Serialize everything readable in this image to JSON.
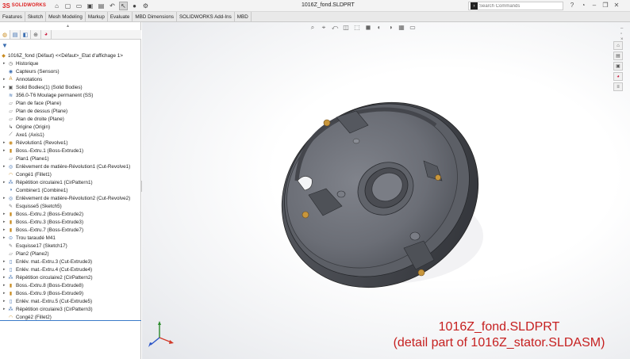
{
  "app": {
    "logo_ds": "3S",
    "logo_text": "SOLIDWORKS"
  },
  "window": {
    "title": "1016Z_fond.SLDPRT"
  },
  "search": {
    "placeholder": "Search Commands"
  },
  "title_icons": [
    "help-icon",
    "user-icon",
    "minimize-icon",
    "restore-icon",
    "close-icon"
  ],
  "quick_access": [
    "home-icon",
    "new-icon",
    "open-icon",
    "save-icon",
    "print-icon",
    "undo-icon",
    "select-icon",
    "rebuild-icon",
    "options-icon"
  ],
  "tabs": [
    {
      "label": "Features",
      "active": false
    },
    {
      "label": "Sketch",
      "active": false
    },
    {
      "label": "Mesh Modeling",
      "active": false
    },
    {
      "label": "Markup",
      "active": false
    },
    {
      "label": "Evaluate",
      "active": false
    },
    {
      "label": "MBD Dimensions",
      "active": false
    },
    {
      "label": "SOLIDWORKS Add-Ins",
      "active": false
    },
    {
      "label": "MBD",
      "active": false
    }
  ],
  "feature_tree": {
    "root": "1016Z_fond (Défaut) <<Défaut>_Etat d'affichage 1>",
    "items": [
      {
        "label": "Historique",
        "icon": "history-icon",
        "expandable": true
      },
      {
        "label": "Capteurs (Sensors)",
        "icon": "sensor-icon",
        "expandable": false
      },
      {
        "label": "Annotations",
        "icon": "annotation-icon",
        "expandable": true
      },
      {
        "label": "Solid Bodies(1) (Solid Bodies)",
        "icon": "solid-bodies-icon",
        "expandable": true
      },
      {
        "label": "356.0-T6 Moulage permanent (SS)",
        "icon": "material-icon",
        "expandable": false
      },
      {
        "label": "Plan de face (Plane)",
        "icon": "plane-icon",
        "expandable": false
      },
      {
        "label": "Plan de dessus (Plane)",
        "icon": "plane-icon",
        "expandable": false
      },
      {
        "label": "Plan de droite (Plane)",
        "icon": "plane-icon",
        "expandable": false
      },
      {
        "label": "Origine (Origin)",
        "icon": "origin-icon",
        "expandable": false
      },
      {
        "label": "Axe1 (Axis1)",
        "icon": "axis-icon",
        "expandable": false
      },
      {
        "label": "Révolution1 (Revolve1)",
        "icon": "revolve-icon",
        "expandable": true
      },
      {
        "label": "Boss.-Extru.1 (Boss-Extrude1)",
        "icon": "extrude-icon",
        "expandable": true
      },
      {
        "label": "Plan1 (Plane1)",
        "icon": "plane-icon",
        "expandable": false
      },
      {
        "label": "Enlèvement de matière-Révolution1 (Cut-Revolve1)",
        "icon": "cut-revolve-icon",
        "expandable": true
      },
      {
        "label": "Congé1 (Fillet1)",
        "icon": "fillet-icon",
        "expandable": false
      },
      {
        "label": "Répétition circulaire1 (CirPattern1)",
        "icon": "pattern-icon",
        "expandable": true
      },
      {
        "label": "Combiner1 (Combine1)",
        "icon": "combine-icon",
        "expandable": false
      },
      {
        "label": "Enlèvement de matière-Révolution2 (Cut-Revolve2)",
        "icon": "cut-revolve-icon",
        "expandable": true
      },
      {
        "label": "Esquisse5 (Sketch5)",
        "icon": "sketch-icon",
        "expandable": false
      },
      {
        "label": "Boss.-Extru.2 (Boss-Extrude2)",
        "icon": "extrude-icon",
        "expandable": true
      },
      {
        "label": "Boss.-Extru.3 (Boss-Extrude3)",
        "icon": "extrude-icon",
        "expandable": true
      },
      {
        "label": "Boss.-Extru.7 (Boss-Extrude7)",
        "icon": "extrude-icon",
        "expandable": true
      },
      {
        "label": "Trou taraudé M41",
        "icon": "hole-icon",
        "expandable": true
      },
      {
        "label": "Esquisse17 (Sketch17)",
        "icon": "sketch-icon",
        "expandable": false
      },
      {
        "label": "Plan2 (Plane2)",
        "icon": "plane-icon",
        "expandable": false
      },
      {
        "label": "Enlév. mat.-Extru.3 (Cut-Extrude3)",
        "icon": "cut-extrude-icon",
        "expandable": true
      },
      {
        "label": "Enlév. mat.-Extru.4 (Cut-Extrude4)",
        "icon": "cut-extrude-icon",
        "expandable": true
      },
      {
        "label": "Répétition circulaire2 (CirPattern2)",
        "icon": "pattern-icon",
        "expandable": true
      },
      {
        "label": "Boss.-Extru.8 (Boss-Extrude8)",
        "icon": "extrude-icon",
        "expandable": true
      },
      {
        "label": "Boss.-Extru.9 (Boss-Extrude9)",
        "icon": "extrude-icon",
        "expandable": true
      },
      {
        "label": "Enlév. mat.-Extru.5 (Cut-Extrude5)",
        "icon": "cut-extrude-icon",
        "expandable": true
      },
      {
        "label": "Répétition circulaire3 (CirPattern3)",
        "icon": "pattern-icon",
        "expandable": true
      },
      {
        "label": "Congé2 (Fillet2)",
        "icon": "fillet-icon",
        "expandable": false
      }
    ]
  },
  "caption": {
    "line1": "1016Z_fond.SLDPRT",
    "line2": "(detail part of 1016Z_stator.SLDASM)"
  },
  "colors": {
    "brand": "#d22222",
    "caption": "#c62020",
    "model_face": "#6e7179",
    "model_dark": "#3d3f45",
    "insert": "#c8963c"
  }
}
